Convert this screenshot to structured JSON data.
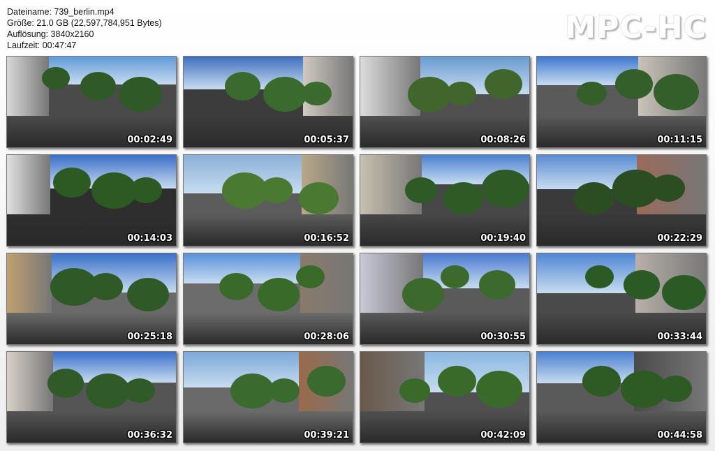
{
  "file_info": {
    "filename_line": "Dateiname: 739_berlin.mp4",
    "size_line": "Größe: 21.0 GB (22,597,784,951 Bytes)",
    "resolution_line": "Auflösung: 3840x2160",
    "duration_line": "Laufzeit: 00:47:47"
  },
  "logo_text": "MPC-HC",
  "thumbnails": [
    {
      "time": "00:02:49",
      "sky": "#5f9ad8",
      "road": "#4a4a4a",
      "tree": "#2f5a28",
      "bldg": "#d8d8d8"
    },
    {
      "time": "00:05:37",
      "sky": "#3f6fc0",
      "road": "#3c3c3c",
      "tree": "#3a6a2e",
      "bldg": "#cfc9bf"
    },
    {
      "time": "00:08:26",
      "sky": "#6a9ad0",
      "road": "#505050",
      "tree": "#40662c",
      "bldg": "#dcdcdc"
    },
    {
      "time": "00:11:15",
      "sky": "#3e78d0",
      "road": "#5a5a5a",
      "tree": "#355f2a",
      "bldg": "#c9c3b8"
    },
    {
      "time": "00:14:03",
      "sky": "#3a6ec8",
      "road": "#2e2e2e",
      "tree": "#2c5a22",
      "bldg": "#e0e0e0"
    },
    {
      "time": "00:16:52",
      "sky": "#8ab0d8",
      "road": "#5c5c5c",
      "tree": "#4a7a32",
      "bldg": "#b8a888"
    },
    {
      "time": "00:19:40",
      "sky": "#4a80d0",
      "road": "#474747",
      "tree": "#2e5a26",
      "bldg": "#c8c0b0"
    },
    {
      "time": "00:22:29",
      "sky": "#5a8cd0",
      "road": "#3a3a3a",
      "tree": "#2a4e22",
      "bldg": "#9a6a5a"
    },
    {
      "time": "00:25:18",
      "sky": "#3a70c8",
      "road": "#6a6a6a",
      "tree": "#2f5a28",
      "bldg": "#c0a070"
    },
    {
      "time": "00:28:06",
      "sky": "#5a90d8",
      "road": "#6c6c6c",
      "tree": "#3a6a2a",
      "bldg": "#8a7a6a"
    },
    {
      "time": "00:30:55",
      "sky": "#4a7ad0",
      "road": "#5a5a5a",
      "tree": "#3c6a2c",
      "bldg": "#c8c8d8"
    },
    {
      "time": "00:33:44",
      "sky": "#4f86d4",
      "road": "#4a4a4a",
      "tree": "#2c5a24",
      "bldg": "#b8b0a8"
    },
    {
      "time": "00:36:32",
      "sky": "#3a70c8",
      "road": "#555555",
      "tree": "#305a28",
      "bldg": "#d8d0c8"
    },
    {
      "time": "00:39:21",
      "sky": "#7aa8d8",
      "road": "#6a6a6a",
      "tree": "#3a6a2e",
      "bldg": "#9a6a4a"
    },
    {
      "time": "00:42:09",
      "sky": "#8ab8e0",
      "road": "#505050",
      "tree": "#3a6a2a",
      "bldg": "#6a5a4a"
    },
    {
      "time": "00:44:58",
      "sky": "#4a80d0",
      "road": "#5a5a5a",
      "tree": "#2e5a24",
      "bldg": "#4a4a4a"
    }
  ]
}
